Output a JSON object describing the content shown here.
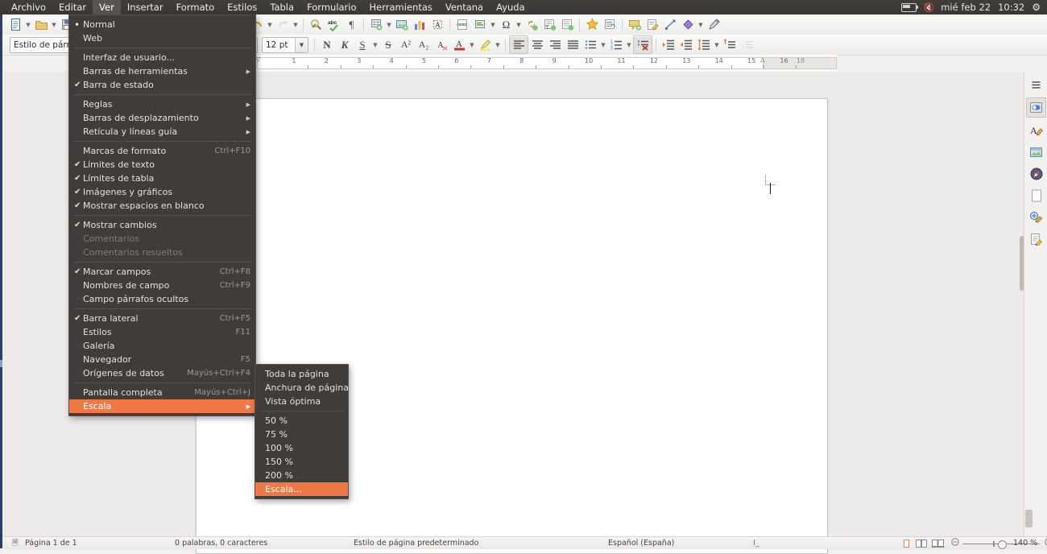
{
  "desktop": {
    "menubar": [
      {
        "label": "Archivo",
        "active": false
      },
      {
        "label": "Editar",
        "active": false
      },
      {
        "label": "Ver",
        "active": true
      },
      {
        "label": "Insertar",
        "active": false
      },
      {
        "label": "Formato",
        "active": false
      },
      {
        "label": "Estilos",
        "active": false
      },
      {
        "label": "Tabla",
        "active": false
      },
      {
        "label": "Formulario",
        "active": false
      },
      {
        "label": "Herramientas",
        "active": false
      },
      {
        "label": "Ventana",
        "active": false
      },
      {
        "label": "Ayuda",
        "active": false
      }
    ],
    "tray": {
      "battery_icon": "battery-icon",
      "volume_icon": "volume-muted-icon",
      "date": "mié feb 22",
      "time": "10:32",
      "settings_icon": "gear-icon"
    }
  },
  "toolbar1": {
    "items": [
      {
        "name": "new-document-button",
        "glyph": "doc",
        "dropdown": true
      },
      {
        "name": "open-document-button",
        "glyph": "folder",
        "dropdown": true
      },
      {
        "name": "save-button",
        "glyph": "save",
        "dropdown": true
      },
      {
        "name": "export-pdf-button",
        "glyph": "pdf"
      },
      {
        "name": "print-button",
        "glyph": "printer"
      },
      {
        "name": "print-preview-button",
        "glyph": "preview"
      },
      {
        "name": "cut-button",
        "glyph": "cut"
      },
      {
        "name": "copy-button",
        "glyph": "copy"
      },
      {
        "name": "paste-button",
        "glyph": "paste",
        "dropdown": true
      },
      {
        "name": "clone-formatting-button",
        "glyph": "brush"
      },
      {
        "name": "clear-formatting-button",
        "glyph": "clear"
      },
      {
        "name": "undo-button",
        "glyph": "undo",
        "dropdown": true
      },
      {
        "name": "redo-button",
        "glyph": "redo",
        "dropdown": true
      },
      {
        "name": "find-replace-button",
        "glyph": "find"
      },
      {
        "name": "spelling-button",
        "glyph": "abc"
      },
      {
        "name": "formatting-marks-button",
        "glyph": "pilcrow"
      },
      {
        "name": "insert-table-button",
        "glyph": "table",
        "dropdown": true
      },
      {
        "name": "insert-image-button",
        "glyph": "image"
      },
      {
        "name": "insert-chart-button",
        "glyph": "chart"
      },
      {
        "name": "insert-textbox-button",
        "glyph": "textbox"
      },
      {
        "name": "insert-page-break-button",
        "glyph": "pagebreak"
      },
      {
        "name": "insert-field-button",
        "glyph": "field",
        "dropdown": true
      },
      {
        "name": "insert-special-character-button",
        "glyph": "omega",
        "dropdown": true
      },
      {
        "name": "insert-hyperlink-button",
        "glyph": "link"
      },
      {
        "name": "insert-footnote-button",
        "glyph": "footnote"
      },
      {
        "name": "insert-endnote-button",
        "glyph": "endnote"
      },
      {
        "name": "insert-bookmark-button",
        "glyph": "star"
      },
      {
        "name": "insert-cross-reference-button",
        "glyph": "xref"
      },
      {
        "name": "insert-comment-button",
        "glyph": "comment"
      },
      {
        "name": "track-changes-button",
        "glyph": "trackchanges"
      },
      {
        "name": "insert-line-button",
        "glyph": "line"
      },
      {
        "name": "basic-shapes-button",
        "glyph": "shape",
        "dropdown": true
      },
      {
        "name": "show-draw-functions-button",
        "glyph": "draw"
      }
    ]
  },
  "toolbar2": {
    "paragraph_style": {
      "value": "Estilo de párrafo",
      "placeholder": "Estilo de párrafo"
    },
    "font_name": {
      "value": "",
      "placeholder": ""
    },
    "font_size": {
      "value": "12 pt",
      "placeholder": "12 pt"
    },
    "bold_label": "N",
    "italic_label": "K",
    "underline_label": "S",
    "strikethrough_label": "S",
    "superscript_label": "A²",
    "subscript_label": "A₂",
    "items": [
      {
        "name": "toggle-formatting-marks-button",
        "glyph": "clearfmt"
      },
      {
        "name": "font-color-button",
        "glyph": "fontcolor",
        "dropdown": true
      },
      {
        "name": "highlight-color-button",
        "glyph": "highlight",
        "dropdown": true
      },
      {
        "name": "align-left-button",
        "glyph": "alignleft",
        "active": true
      },
      {
        "name": "align-center-button",
        "glyph": "aligncenter"
      },
      {
        "name": "align-right-button",
        "glyph": "alignright"
      },
      {
        "name": "align-justified-button",
        "glyph": "alignjustify"
      },
      {
        "name": "unordered-list-button",
        "glyph": "bullets",
        "dropdown": true
      },
      {
        "name": "ordered-list-button",
        "glyph": "numbers",
        "dropdown": true
      },
      {
        "name": "no-list-button",
        "glyph": "nolist",
        "active": true
      },
      {
        "name": "increase-indent-button",
        "glyph": "indentplus"
      },
      {
        "name": "decrease-indent-button",
        "glyph": "indentminus"
      },
      {
        "name": "line-spacing-button",
        "glyph": "linespacing",
        "dropdown": true
      },
      {
        "name": "paragraph-spacing-above-button",
        "glyph": "spaceabove"
      },
      {
        "name": "paragraph-spacing-below-button",
        "glyph": "spacebelow"
      }
    ]
  },
  "ruler": {
    "unit_numbers": [
      "1",
      "2",
      "3",
      "4",
      "5",
      "6",
      "7",
      "8",
      "9",
      "10",
      "11",
      "12",
      "13",
      "14",
      "15",
      "16"
    ],
    "right_margin_number": "18"
  },
  "view_menu": {
    "items": [
      {
        "label": "Normal",
        "bullet": true,
        "check": false,
        "accel": "",
        "submenu": false,
        "disabled": false,
        "selected": false
      },
      {
        "label": "Web",
        "bullet": false,
        "check": false,
        "accel": "",
        "submenu": false,
        "disabled": false,
        "selected": false
      },
      {
        "separator": true
      },
      {
        "label": "Interfaz de usuario...",
        "bullet": false,
        "check": false,
        "accel": "",
        "submenu": false,
        "disabled": false,
        "selected": false
      },
      {
        "label": "Barras de herramientas",
        "bullet": false,
        "check": false,
        "accel": "",
        "submenu": true,
        "disabled": false,
        "selected": false
      },
      {
        "label": "Barra de estado",
        "bullet": false,
        "check": true,
        "accel": "",
        "submenu": false,
        "disabled": false,
        "selected": false
      },
      {
        "separator": true
      },
      {
        "label": "Reglas",
        "bullet": false,
        "check": false,
        "accel": "",
        "submenu": true,
        "disabled": false,
        "selected": false
      },
      {
        "label": "Barras de desplazamiento",
        "bullet": false,
        "check": false,
        "accel": "",
        "submenu": true,
        "disabled": false,
        "selected": false
      },
      {
        "label": "Retícula y líneas guía",
        "bullet": false,
        "check": false,
        "accel": "",
        "submenu": true,
        "disabled": false,
        "selected": false
      },
      {
        "separator": true
      },
      {
        "label": "Marcas de formato",
        "bullet": false,
        "check": false,
        "accel": "Ctrl+F10",
        "submenu": false,
        "disabled": false,
        "selected": false
      },
      {
        "label": "Límites de texto",
        "bullet": false,
        "check": true,
        "accel": "",
        "submenu": false,
        "disabled": false,
        "selected": false
      },
      {
        "label": "Límites de tabla",
        "bullet": false,
        "check": true,
        "accel": "",
        "submenu": false,
        "disabled": false,
        "selected": false
      },
      {
        "label": "Imágenes y gráficos",
        "bullet": false,
        "check": true,
        "accel": "",
        "submenu": false,
        "disabled": false,
        "selected": false
      },
      {
        "label": "Mostrar espacios en blanco",
        "bullet": false,
        "check": true,
        "accel": "",
        "submenu": false,
        "disabled": false,
        "selected": false
      },
      {
        "separator": true
      },
      {
        "label": "Mostrar cambios",
        "bullet": false,
        "check": true,
        "accel": "",
        "submenu": false,
        "disabled": false,
        "selected": false
      },
      {
        "label": "Comentarios",
        "bullet": false,
        "check": false,
        "accel": "",
        "submenu": false,
        "disabled": true,
        "selected": false
      },
      {
        "label": "Comentarios resueltos",
        "bullet": false,
        "check": false,
        "accel": "",
        "submenu": false,
        "disabled": true,
        "selected": false
      },
      {
        "separator": true
      },
      {
        "label": "Marcar campos",
        "bullet": false,
        "check": true,
        "accel": "Ctrl+F8",
        "submenu": false,
        "disabled": false,
        "selected": false
      },
      {
        "label": "Nombres de campo",
        "bullet": false,
        "check": false,
        "accel": "Ctrl+F9",
        "submenu": false,
        "disabled": false,
        "selected": false
      },
      {
        "label": "Campo párrafos ocultos",
        "bullet": false,
        "check": false,
        "accel": "",
        "submenu": false,
        "disabled": false,
        "selected": false
      },
      {
        "separator": true
      },
      {
        "label": "Barra lateral",
        "bullet": false,
        "check": true,
        "accel": "Ctrl+F5",
        "submenu": false,
        "disabled": false,
        "selected": false
      },
      {
        "label": "Estilos",
        "bullet": false,
        "check": false,
        "accel": "F11",
        "submenu": false,
        "disabled": false,
        "selected": false
      },
      {
        "label": "Galería",
        "bullet": false,
        "check": false,
        "accel": "",
        "submenu": false,
        "disabled": false,
        "selected": false
      },
      {
        "label": "Navegador",
        "bullet": false,
        "check": false,
        "accel": "F5",
        "submenu": false,
        "disabled": false,
        "selected": false
      },
      {
        "label": "Orígenes de datos",
        "bullet": false,
        "check": false,
        "accel": "Mayús+Ctrl+F4",
        "submenu": false,
        "disabled": false,
        "selected": false
      },
      {
        "separator": true
      },
      {
        "label": "Pantalla completa",
        "bullet": false,
        "check": false,
        "accel": "Mayús+Ctrl+J",
        "submenu": false,
        "disabled": false,
        "selected": false
      },
      {
        "label": "Escala",
        "bullet": false,
        "check": false,
        "accel": "",
        "submenu": true,
        "disabled": false,
        "selected": true
      }
    ]
  },
  "scale_submenu": {
    "items": [
      {
        "label": "Toda la página",
        "selected": false
      },
      {
        "label": "Anchura de página",
        "selected": false
      },
      {
        "label": "Vista óptima",
        "selected": false
      },
      {
        "separator": true
      },
      {
        "label": "50 %",
        "selected": false
      },
      {
        "label": "75 %",
        "selected": false
      },
      {
        "label": "100 %",
        "selected": false
      },
      {
        "label": "150 %",
        "selected": false
      },
      {
        "label": "200 %",
        "selected": false
      },
      {
        "label": "Escala...",
        "selected": true
      }
    ]
  },
  "sidebar": {
    "items": [
      {
        "name": "sidebar-settings-icon",
        "glyph": "hamburger",
        "active": false
      },
      {
        "name": "sidebar-item-properties",
        "glyph": "properties",
        "active": true
      },
      {
        "name": "sidebar-item-styles",
        "glyph": "styles",
        "active": false
      },
      {
        "name": "sidebar-item-gallery",
        "glyph": "gallery",
        "active": false
      },
      {
        "name": "sidebar-item-navigator",
        "glyph": "navigator",
        "active": false
      },
      {
        "name": "sidebar-item-page",
        "glyph": "page",
        "active": false
      },
      {
        "name": "sidebar-item-style-inspector",
        "glyph": "inspector",
        "active": false
      },
      {
        "name": "sidebar-item-manage-changes",
        "glyph": "changes",
        "active": false
      }
    ]
  },
  "statusbar": {
    "page_info": "Página 1 de 1",
    "word_count": "0 palabras, 0 caracteres",
    "page_style": "Estilo de página predeterminado",
    "language": "Español (España)",
    "selection_mode": "I_",
    "zoom_level": "140 %",
    "view_layout": [
      "single-page-view-icon",
      "multi-page-view-icon",
      "book-view-icon"
    ],
    "zoom_out_icon": "zoom-out-icon",
    "zoom_in_icon": "zoom-in-icon"
  },
  "colors": {
    "menu_bg": "#403c39",
    "highlight": "#f07746",
    "panel_bg": "#3b3734",
    "launcher": "#2c3e6b",
    "toolbar_bg": "#f2f1f0"
  }
}
